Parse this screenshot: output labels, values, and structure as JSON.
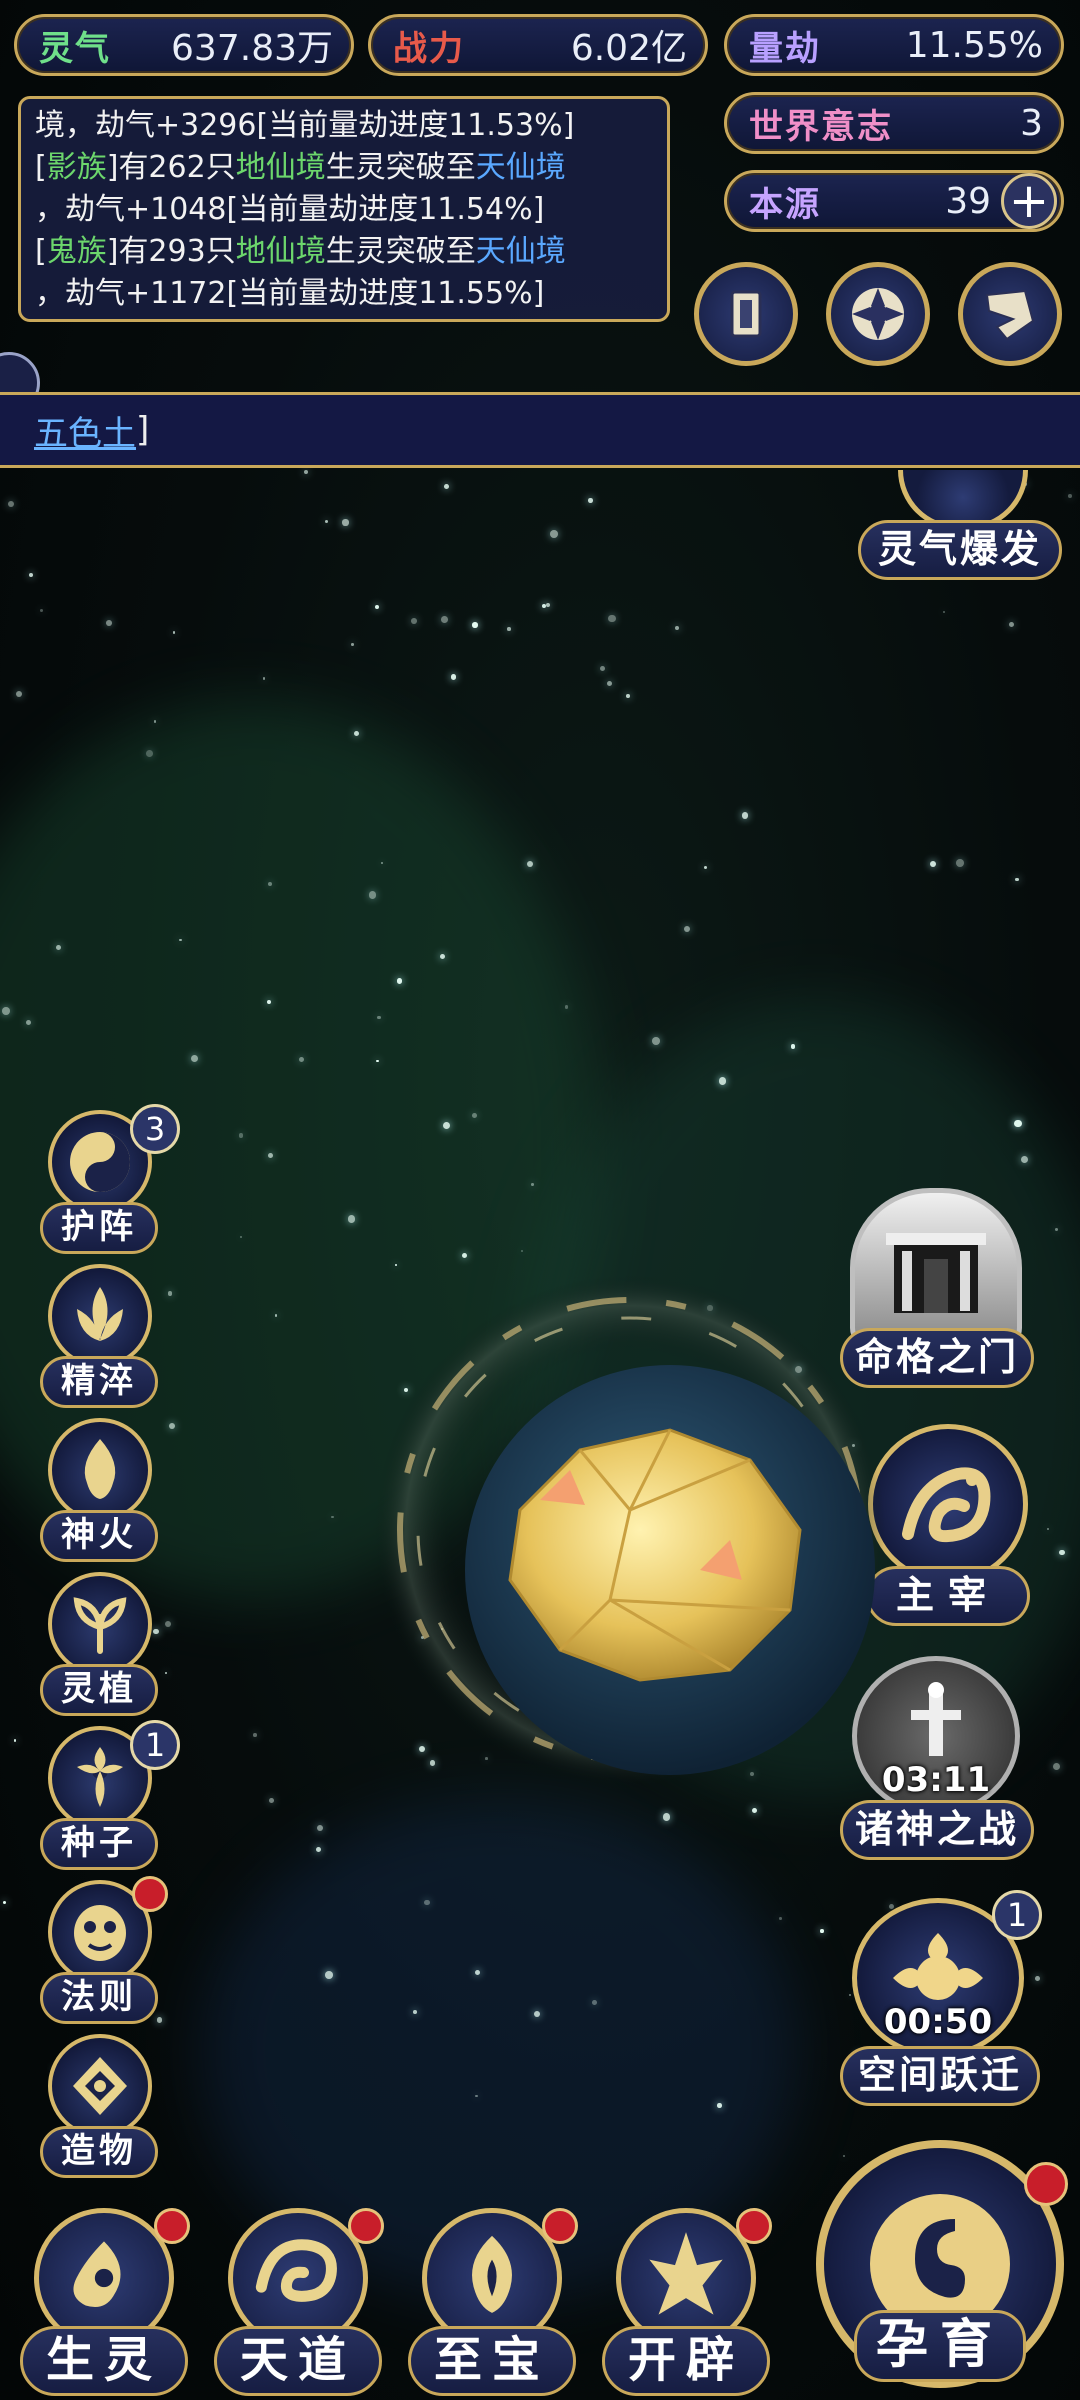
{
  "stats": {
    "lingqi": {
      "label": "灵气",
      "value": "637.83万",
      "color": "#6fe08a"
    },
    "zhanli": {
      "label": "战力",
      "value": "6.02亿",
      "color": "#e85a4a"
    },
    "liangjie": {
      "label": "量劫",
      "value": "11.55%",
      "color": "#b8a0ff"
    },
    "shijieyizhi": {
      "label": "世界意志",
      "value": "3",
      "color": "#f08fc8"
    },
    "benyuan": {
      "label": "本源",
      "value": "39",
      "color": "#c6a4ff"
    }
  },
  "log": {
    "line1": "境，劫气+3296[当前量劫进度11.53%]",
    "entry2": {
      "lb": "[",
      "clan": "影族",
      "rb": "]",
      "mid1": "有262只",
      "realm1": "地仙境",
      "mid2": "生灵突破至",
      "realm2": "天仙境",
      "tail": "，劫气+1048[当前量劫进度11.54%]"
    },
    "entry3": {
      "lb": "[",
      "clan": "鬼族",
      "rb": "]",
      "mid1": "有293只",
      "realm1": "地仙境",
      "mid2": "生灵突破至",
      "realm2": "天仙境",
      "tail": "，劫气+1172[当前量劫进度11.55%]"
    }
  },
  "top_icons": [
    "card-icon",
    "vortex-icon",
    "scroll-icon"
  ],
  "ticker": {
    "link": "五色土",
    "bracket": "]"
  },
  "right_top": {
    "label": "灵气爆发"
  },
  "left_menu": [
    {
      "key": "huzhen",
      "label": "护阵",
      "badge": "3",
      "icon": "taiji-icon"
    },
    {
      "key": "jingcui",
      "label": "精淬",
      "icon": "lotus-flame-icon"
    },
    {
      "key": "shenhuo",
      "label": "神火",
      "icon": "fire-icon"
    },
    {
      "key": "lingzhi",
      "label": "灵植",
      "icon": "plant-icon"
    },
    {
      "key": "zhongzi",
      "label": "种子",
      "badge": "1",
      "icon": "flower-icon"
    },
    {
      "key": "faze",
      "label": "法则",
      "dot": true,
      "icon": "mask-icon"
    },
    {
      "key": "zaowu",
      "label": "造物",
      "icon": "crest-icon"
    }
  ],
  "right_menu": {
    "mingge": {
      "label": "命格之门"
    },
    "zhuzai": {
      "label": "主宰"
    },
    "zhushen": {
      "label": "诸神之战",
      "timer": "03:11"
    },
    "kongjian": {
      "label": "空间跃迁",
      "timer": "00:50",
      "badge": "1"
    }
  },
  "bottom_nav": [
    {
      "key": "shengling",
      "label": "生灵"
    },
    {
      "key": "tiandao",
      "label": "天道"
    },
    {
      "key": "zhibao",
      "label": "至宝"
    },
    {
      "key": "kaipi",
      "label": "开辟"
    }
  ],
  "yunyu": {
    "label": "孕育"
  },
  "colors": {
    "gold": "#c9a85a",
    "green_text": "#6cd66c",
    "blue_text": "#5aa8ff",
    "badge_red": "#c81e2a"
  }
}
